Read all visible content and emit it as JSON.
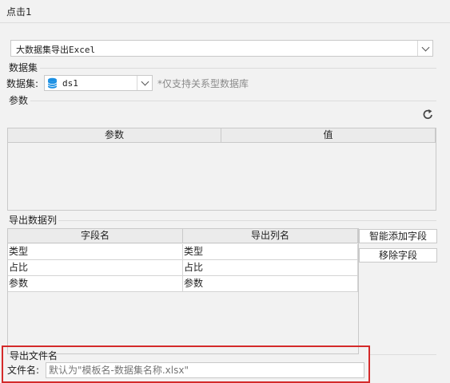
{
  "window": {
    "title": "点击1"
  },
  "export_type": {
    "selected": "大数据集导出Excel"
  },
  "dataset_section": {
    "heading": "数据集",
    "field_label": "数据集:",
    "selected": "ds1",
    "hint": "*仅支持关系型数据库"
  },
  "params_section": {
    "heading": "参数",
    "columns": [
      "参数",
      "值"
    ]
  },
  "export_columns_section": {
    "heading": "导出数据列",
    "columns": [
      "字段名",
      "导出列名"
    ],
    "rows": [
      {
        "field": "类型",
        "export_name": "类型"
      },
      {
        "field": "占比",
        "export_name": "占比"
      },
      {
        "field": "参数",
        "export_name": "参数"
      }
    ],
    "smart_add_label": "智能添加字段",
    "remove_label": "移除字段"
  },
  "filename_section": {
    "heading": "导出文件名",
    "field_label": "文件名:",
    "placeholder": "默认为\"模板名-数据集名称.xlsx\""
  },
  "colors": {
    "highlight_border": "#d42a2a",
    "db_icon": "#1a8fe3"
  }
}
